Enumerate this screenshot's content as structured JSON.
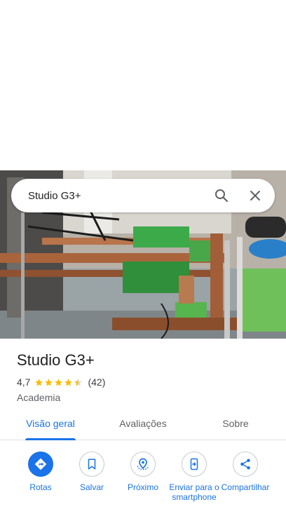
{
  "search": {
    "query": "Studio G3+"
  },
  "place": {
    "name": "Studio G3+",
    "rating": "4,7",
    "stars": 4.5,
    "review_count": "(42)",
    "category": "Academia"
  },
  "tabs": [
    {
      "label": "Visão geral",
      "active": true
    },
    {
      "label": "Avaliações",
      "active": false
    },
    {
      "label": "Sobre",
      "active": false
    }
  ],
  "actions": [
    {
      "label": "Rotas",
      "icon": "directions-icon"
    },
    {
      "label": "Salvar",
      "icon": "bookmark-icon"
    },
    {
      "label": "Próximo",
      "icon": "nearby-icon"
    },
    {
      "label": "Enviar para o smartphone",
      "icon": "send-to-phone-icon"
    },
    {
      "label": "Compartilhar",
      "icon": "share-icon"
    }
  ],
  "colors": {
    "accent": "#1a73e8",
    "star": "#fbbc04",
    "text_primary": "#202124",
    "text_secondary": "#5f6368"
  }
}
